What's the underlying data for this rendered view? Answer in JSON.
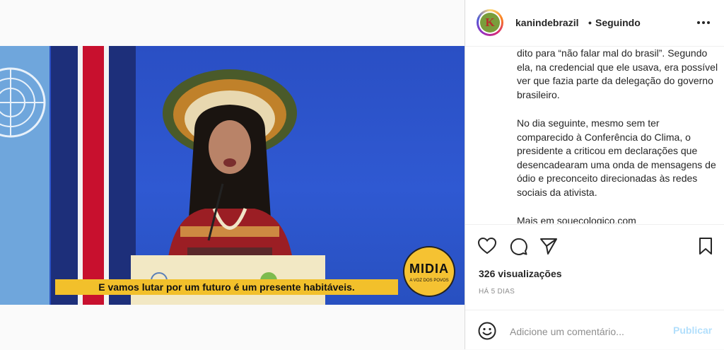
{
  "post": {
    "username": "kanindebrazil",
    "separator": "•",
    "follow_status": "Seguindo",
    "avatar_letter": "K"
  },
  "video": {
    "subtitle": "E vamos lutar por um futuro é um presente habitáveis.",
    "badge_text": "MIDIA",
    "badge_subtext": "A VOZ DOS POVOS"
  },
  "caption": {
    "paragraphs": [
      "dito para “não falar mal do brasil”. Segundo ela, na credencial que ele usava, era possível ver que fazia parte da delegação do governo brasileiro.",
      "No dia seguinte, mesmo sem ter comparecido à Conferência do Clima, o presidente a criticou em declarações que desencadearam uma onda de mensagens de ódio e preconceito direcionadas às redes sociais da ativista.",
      "Mais em souecologico.com"
    ]
  },
  "stats": {
    "views": "326 visualizações",
    "posted": "HÁ 5 DIAS"
  },
  "comment": {
    "placeholder": "Adicione um comentário...",
    "submit": "Publicar"
  },
  "colors": {
    "publish_disabled": "#b2dffc",
    "subtitle_bg": "#f2c02b",
    "secondary_text": "#8e8e8e"
  }
}
